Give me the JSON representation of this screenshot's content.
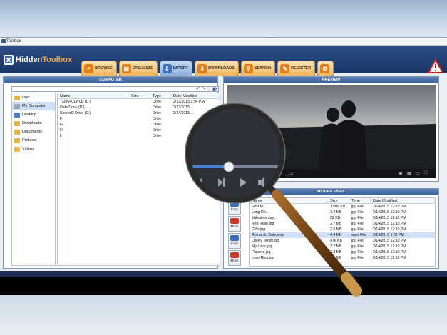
{
  "window": {
    "title": "Toolbox"
  },
  "app": {
    "logo_part1": "Hidden",
    "logo_part2": "Toolbox"
  },
  "tabs": [
    {
      "label": "BROWSE",
      "icon": "binoculars-icon",
      "active": false
    },
    {
      "label": "ORGANIZE",
      "icon": "folder-organize-icon",
      "active": false
    },
    {
      "label": "IMPORT",
      "icon": "import-icon",
      "active": true
    },
    {
      "label": "DOWNLOADS",
      "icon": "download-icon",
      "active": false
    },
    {
      "label": "SEARCH",
      "icon": "search-icon",
      "active": false
    },
    {
      "label": "REGISTER",
      "icon": "register-icon",
      "active": false
    },
    {
      "label": "",
      "icon": "settings-gear-icon",
      "active": false
    }
  ],
  "computer": {
    "title": "COMPUTER",
    "tree": [
      {
        "label": "user",
        "icon": "user-folder-icon"
      },
      {
        "label": "My Computer",
        "icon": "computer-icon",
        "selected": true
      },
      {
        "label": "Desktop",
        "icon": "desktop-icon"
      },
      {
        "label": "Downloads",
        "icon": "downloads-folder-icon"
      },
      {
        "label": "Documents",
        "icon": "documents-folder-icon"
      },
      {
        "label": "Pictures",
        "icon": "pictures-folder-icon"
      },
      {
        "label": "Videos",
        "icon": "videos-folder-icon"
      }
    ],
    "columns": [
      "Name",
      "Size",
      "Type",
      "Date Modified"
    ],
    "rows": [
      {
        "name": "TI106401W0D (C:)",
        "size": "",
        "type": "Drive",
        "date": "2/13/2015 2:54 PM"
      },
      {
        "name": "Data Drive (D:)",
        "size": "",
        "type": "Drive",
        "date": "2/13/2015 ..."
      },
      {
        "name": "Shared2 Drive (E:)",
        "size": "",
        "type": "Drive",
        "date": "2/14/2015 ..."
      },
      {
        "name": "F:",
        "size": "",
        "type": "Drive",
        "date": ""
      },
      {
        "name": "G:",
        "size": "",
        "type": "Drive",
        "date": ""
      },
      {
        "name": "H:",
        "size": "",
        "type": "Drive",
        "date": ""
      },
      {
        "name": "I:",
        "size": "",
        "type": "Drive",
        "date": ""
      }
    ]
  },
  "preview": {
    "title": "PREVIEW",
    "time": "1:27",
    "progress": 0.12
  },
  "hidden": {
    "title": "HIDDEN FILES",
    "buttons": [
      "Copy",
      "Move",
      "Copy",
      "Move"
    ],
    "columns": [
      "Name",
      "Size",
      "Type",
      "Date Modified"
    ],
    "rows": [
      {
        "name": "First M...",
        "size": "1,006 KB",
        "type": "jpg File",
        "date": "2/14/2015 12:10 PM"
      },
      {
        "name": "Long Dri...",
        "size": "3.2 MB",
        "type": "jpg File",
        "date": "2/14/2015 12:10 PM"
      },
      {
        "name": "Valentine day...",
        "size": "52 KB",
        "type": "jpg File",
        "date": "2/14/2015 12:10 PM"
      },
      {
        "name": "Red Rose.jpg",
        "size": "2.7 MB",
        "type": "jpg File",
        "date": "2/14/2015 12:10 PM"
      },
      {
        "name": "Gifts.jpg",
        "size": "2.6 MB",
        "type": "jpg File",
        "date": "2/14/2015 12:10 PM"
      },
      {
        "name": "Romantic Date.wmv",
        "size": "4.4 MB",
        "type": "wmv File",
        "date": "2/14/2015 5:32 PM",
        "selected": true
      },
      {
        "name": "Lovely Teddy.jpg",
        "size": "476 KB",
        "type": "jpg File",
        "date": "2/14/2015 12:10 PM"
      },
      {
        "name": "My Love.jpg",
        "size": "3.2 MB",
        "type": "jpg File",
        "date": "2/14/2015 12:10 PM"
      },
      {
        "name": "Flowers.jpg",
        "size": "2.3 MB",
        "type": "jpg File",
        "date": "2/14/2015 12:10 PM"
      },
      {
        "name": "Love Ring.jpg",
        "size": "2.5 MB",
        "type": "jpg File",
        "date": "2/14/2015 12:10 PM"
      }
    ]
  }
}
